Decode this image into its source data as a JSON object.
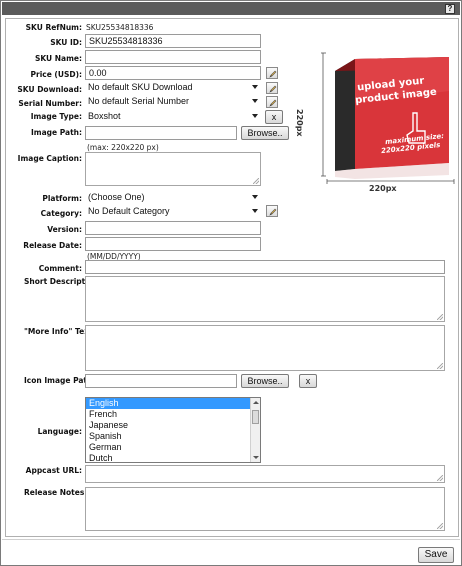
{
  "help_label": "?",
  "fields": {
    "sku_refnum": {
      "label": "SKU RefNum:",
      "value": "SKU25534818336"
    },
    "sku_id": {
      "label": "SKU ID:",
      "value": "SKU25534818336"
    },
    "sku_name": {
      "label": "SKU Name:",
      "value": ""
    },
    "price": {
      "label": "Price (USD):",
      "value": "0.00"
    },
    "sku_download": {
      "label": "SKU Download:",
      "value": "No default SKU Download"
    },
    "serial_number": {
      "label": "Serial Number:",
      "value": "No default Serial Number"
    },
    "image_type": {
      "label": "Image Type:",
      "value": "Boxshot"
    },
    "image_path": {
      "label": "Image Path:",
      "value": "",
      "hint": "(max: 220x220 px)"
    },
    "image_caption": {
      "label": "Image Caption:"
    },
    "platform": {
      "label": "Platform:",
      "value": "(Choose One)"
    },
    "category": {
      "label": "Category:",
      "value": "No Default Category"
    },
    "version": {
      "label": "Version:",
      "value": ""
    },
    "release_date": {
      "label": "Release Date:",
      "value": "",
      "hint": "(MM/DD/YYYY)"
    },
    "comment": {
      "label": "Comment:",
      "value": ""
    },
    "short_description": {
      "label": "Short Description:"
    },
    "more_info": {
      "label": "\"More Info\" Text:"
    },
    "icon_image_path": {
      "label": "Icon Image Path:",
      "value": ""
    },
    "language": {
      "label": "Language:",
      "options": [
        "English",
        "French",
        "Japanese",
        "Spanish",
        "German",
        "Dutch"
      ],
      "selected": "English"
    },
    "appcast_url": {
      "label": "Appcast URL:",
      "value": ""
    },
    "release_notes": {
      "label": "Release Notes:"
    }
  },
  "buttons": {
    "browse": "Browse..",
    "clear": "x",
    "save": "Save"
  },
  "product_image": {
    "text_line1": "upload your",
    "text_line2": "product image",
    "text_line3": "maximum size:",
    "text_line4": "220x220 pixels",
    "width_label": "220px",
    "height_label": "220px",
    "colors": {
      "box_face": "#d9353a",
      "box_side": "#2a2a2a"
    }
  }
}
